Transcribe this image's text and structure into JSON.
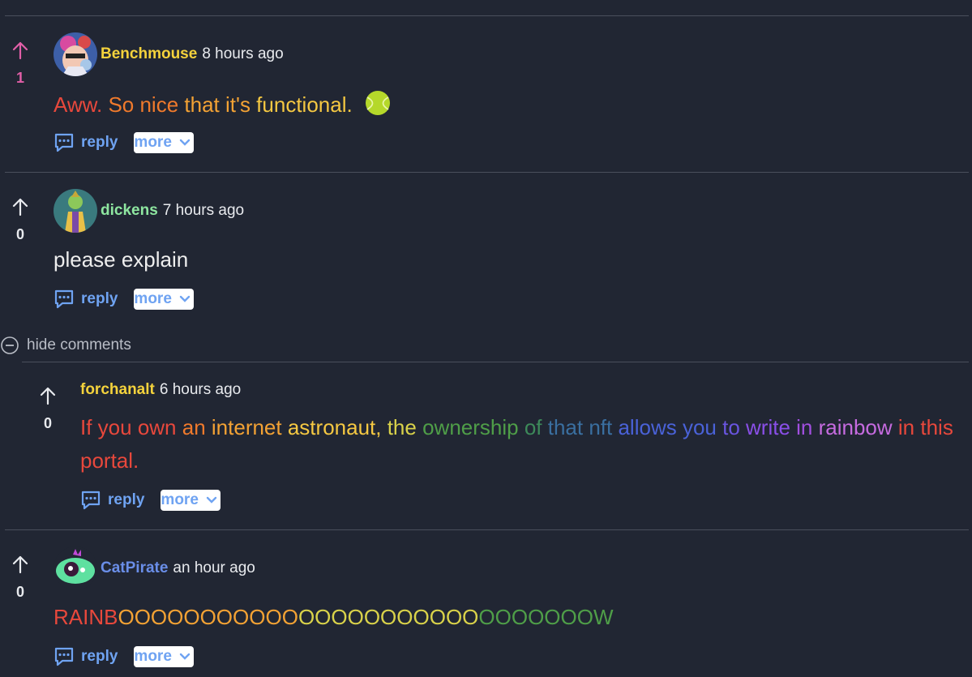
{
  "comments": [
    {
      "author": "Benchmouse",
      "time": "8 hours ago",
      "votes": "1",
      "author_color": "#f4d23c",
      "vote_color": "#e25fa8",
      "body_segments": [
        {
          "text": "Aww.",
          "color": "#e8483c"
        },
        {
          "text": " So nice",
          "color": "#f07a2c"
        },
        {
          "text": " that it's",
          "color": "#f3a234"
        },
        {
          "text": " functional.",
          "color": "#f5c842"
        }
      ],
      "emoji": "tennis-ball-icon"
    },
    {
      "author": "dickens",
      "time": "7 hours ago",
      "votes": "0",
      "author_color": "#8ee6a0",
      "vote_color": "#e8eaee",
      "body_segments": [
        {
          "text": "please explain",
          "color": "#eeeeee"
        }
      ]
    },
    {
      "author": "forchanalt",
      "time": "6 hours ago",
      "votes": "0",
      "author_color": "#f4d23c",
      "vote_color": "#e8eaee",
      "body_segments": [
        {
          "text": "If you own",
          "color": "#e8483c"
        },
        {
          "text": " an",
          "color": "#f07a2c"
        },
        {
          "text": " internet",
          "color": "#f3a234"
        },
        {
          "text": " astronaut,",
          "color": "#f5c842"
        },
        {
          "text": " the",
          "color": "#d9d24a"
        },
        {
          "text": " ownership",
          "color": "#4f9e48"
        },
        {
          "text": " of",
          "color": "#3d8a5a"
        },
        {
          "text": " that nft",
          "color": "#3a6fa0"
        },
        {
          "text": " allows you",
          "color": "#4a62d8"
        },
        {
          "text": " to",
          "color": "#6a55e0"
        },
        {
          "text": " write",
          "color": "#8a4fe8"
        },
        {
          "text": " in",
          "color": "#a24fe0"
        },
        {
          "text": " rainbow",
          "color": "#c66be0"
        },
        {
          "text": " in this portal.",
          "color": "#e8483c"
        }
      ]
    },
    {
      "author": "CatPirate",
      "time": "an hour ago",
      "votes": "0",
      "author_color": "#6a8ee8",
      "vote_color": "#e8eaee",
      "body_segments": [
        {
          "text": "RAINB",
          "color": "#e8483c"
        },
        {
          "text": "OOOOOOOOOOO",
          "color": "#f3a234"
        },
        {
          "text": "OOOOOOOOOOO",
          "color": "#d9d24a"
        },
        {
          "text": "OOOOOOOW",
          "color": "#4f9e48"
        }
      ]
    }
  ],
  "labels": {
    "reply": "reply",
    "more": "more",
    "hide_comments": "hide comments"
  },
  "colors": {
    "background": "#212633",
    "link": "#6fa3f2",
    "divider": "#4a4f5c"
  }
}
